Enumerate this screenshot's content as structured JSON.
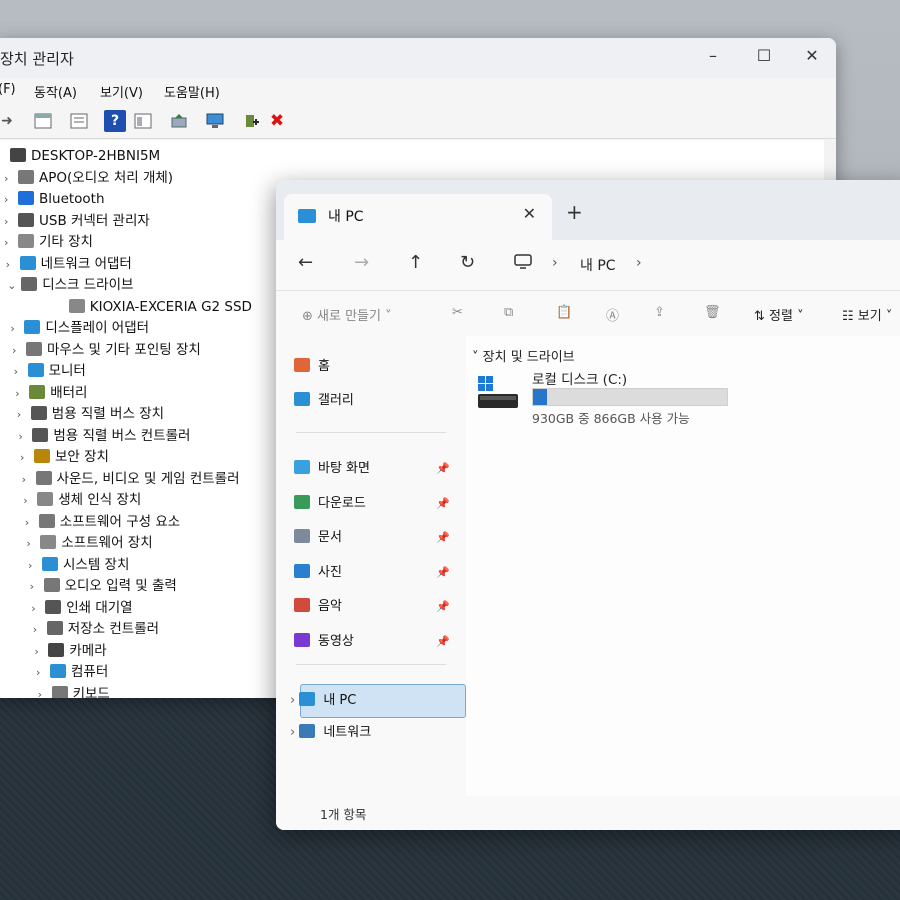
{
  "device_manager": {
    "title": "장치 관리자",
    "menu": [
      "(F)",
      "동작(A)",
      "보기(V)",
      "도움말(H)"
    ],
    "tree": [
      {
        "label": "DESKTOP-2HBNI5M",
        "level": 0,
        "chev": "",
        "icon": "computer-icon",
        "color": "#444"
      },
      {
        "label": "APO(오디오 처리 개체)",
        "level": 1,
        "chev": ">",
        "icon": "speaker-icon",
        "color": "#777"
      },
      {
        "label": "Bluetooth",
        "level": 1,
        "chev": ">",
        "icon": "bluetooth-icon",
        "color": "#1e6fd9"
      },
      {
        "label": "USB 커넥터 관리자",
        "level": 1,
        "chev": ">",
        "icon": "usb-icon",
        "color": "#555"
      },
      {
        "label": "기타 장치",
        "level": 1,
        "chev": ">",
        "icon": "unknown-device-icon",
        "color": "#888"
      },
      {
        "label": "네트워크 어댑터",
        "level": 1,
        "chev": ">",
        "icon": "network-adapter-icon",
        "color": "#2b8fd6"
      },
      {
        "label": "디스크 드라이브",
        "level": 1,
        "chev": "v",
        "icon": "disk-drive-icon",
        "color": "#666"
      },
      {
        "label": "KIOXIA-EXCERIA G2 SSD",
        "level": 2,
        "chev": "",
        "icon": "ssd-icon",
        "color": "#888"
      },
      {
        "label": "디스플레이 어댑터",
        "level": 1,
        "chev": ">",
        "icon": "display-adapter-icon",
        "color": "#2b8fd6"
      },
      {
        "label": "마우스 및 기타 포인팅 장치",
        "level": 1,
        "chev": ">",
        "icon": "mouse-icon",
        "color": "#777"
      },
      {
        "label": "모니터",
        "level": 1,
        "chev": ">",
        "icon": "monitor-icon",
        "color": "#2b8fd6"
      },
      {
        "label": "배터리",
        "level": 1,
        "chev": ">",
        "icon": "battery-icon",
        "color": "#6a8a3a"
      },
      {
        "label": "범용 직렬 버스 장치",
        "level": 1,
        "chev": ">",
        "icon": "usb-device-icon",
        "color": "#555"
      },
      {
        "label": "범용 직렬 버스 컨트롤러",
        "level": 1,
        "chev": ">",
        "icon": "usb-controller-icon",
        "color": "#555"
      },
      {
        "label": "보안 장치",
        "level": 1,
        "chev": ">",
        "icon": "security-device-icon",
        "color": "#b8860b"
      },
      {
        "label": "사운드, 비디오 및 게임 컨트롤러",
        "level": 1,
        "chev": ">",
        "icon": "sound-icon",
        "color": "#777"
      },
      {
        "label": "생체 인식 장치",
        "level": 1,
        "chev": ">",
        "icon": "biometric-icon",
        "color": "#888"
      },
      {
        "label": "소프트웨어 구성 요소",
        "level": 1,
        "chev": ">",
        "icon": "software-component-icon",
        "color": "#777"
      },
      {
        "label": "소프트웨어 장치",
        "level": 1,
        "chev": ">",
        "icon": "software-device-icon",
        "color": "#888"
      },
      {
        "label": "시스템 장치",
        "level": 1,
        "chev": ">",
        "icon": "system-device-icon",
        "color": "#2b8fd6"
      },
      {
        "label": "오디오 입력 및 출력",
        "level": 1,
        "chev": ">",
        "icon": "audio-io-icon",
        "color": "#777"
      },
      {
        "label": "인쇄 대기열",
        "level": 1,
        "chev": ">",
        "icon": "printer-icon",
        "color": "#555"
      },
      {
        "label": "저장소 컨트롤러",
        "level": 1,
        "chev": ">",
        "icon": "storage-controller-icon",
        "color": "#666"
      },
      {
        "label": "카메라",
        "level": 1,
        "chev": ">",
        "icon": "camera-icon",
        "color": "#444"
      },
      {
        "label": "컴퓨터",
        "level": 1,
        "chev": ">",
        "icon": "computer-icon",
        "color": "#2b8fd6"
      },
      {
        "label": "키보드",
        "level": 1,
        "chev": ">",
        "icon": "keyboard-icon",
        "color": "#777"
      }
    ]
  },
  "explorer": {
    "tab_title": "내 PC",
    "new_tab": "+",
    "address": [
      "내 PC"
    ],
    "commands": {
      "new": "새로 만들기",
      "sort": "정렬",
      "view": "보기"
    },
    "nav_pane": {
      "top": [
        {
          "label": "홈",
          "icon": "home-icon",
          "color": "#e0663a"
        },
        {
          "label": "갤러리",
          "icon": "gallery-icon",
          "color": "#2b8fd6"
        }
      ],
      "pinned": [
        {
          "label": "바탕 화면",
          "icon": "desktop-icon",
          "color": "#3aa0e0"
        },
        {
          "label": "다운로드",
          "icon": "download-icon",
          "color": "#3a9a5a"
        },
        {
          "label": "문서",
          "icon": "documents-icon",
          "color": "#7c8a9c"
        },
        {
          "label": "사진",
          "icon": "pictures-icon",
          "color": "#2b7fd0"
        },
        {
          "label": "음악",
          "icon": "music-icon",
          "color": "#d24a3a"
        },
        {
          "label": "동영상",
          "icon": "videos-icon",
          "color": "#7a3ad2"
        }
      ],
      "bottom": [
        {
          "label": "내 PC",
          "icon": "this-pc-icon",
          "color": "#2b8fd6"
        },
        {
          "label": "네트워크",
          "icon": "network-icon",
          "color": "#3a7ab8"
        }
      ]
    },
    "content": {
      "section": "장치 및 드라이브",
      "drive": {
        "name": "로컬 디스크 (C:)",
        "info": "930GB 중 866GB 사용 가능",
        "used_fraction": 0.07
      }
    },
    "status": "1개 항목"
  }
}
